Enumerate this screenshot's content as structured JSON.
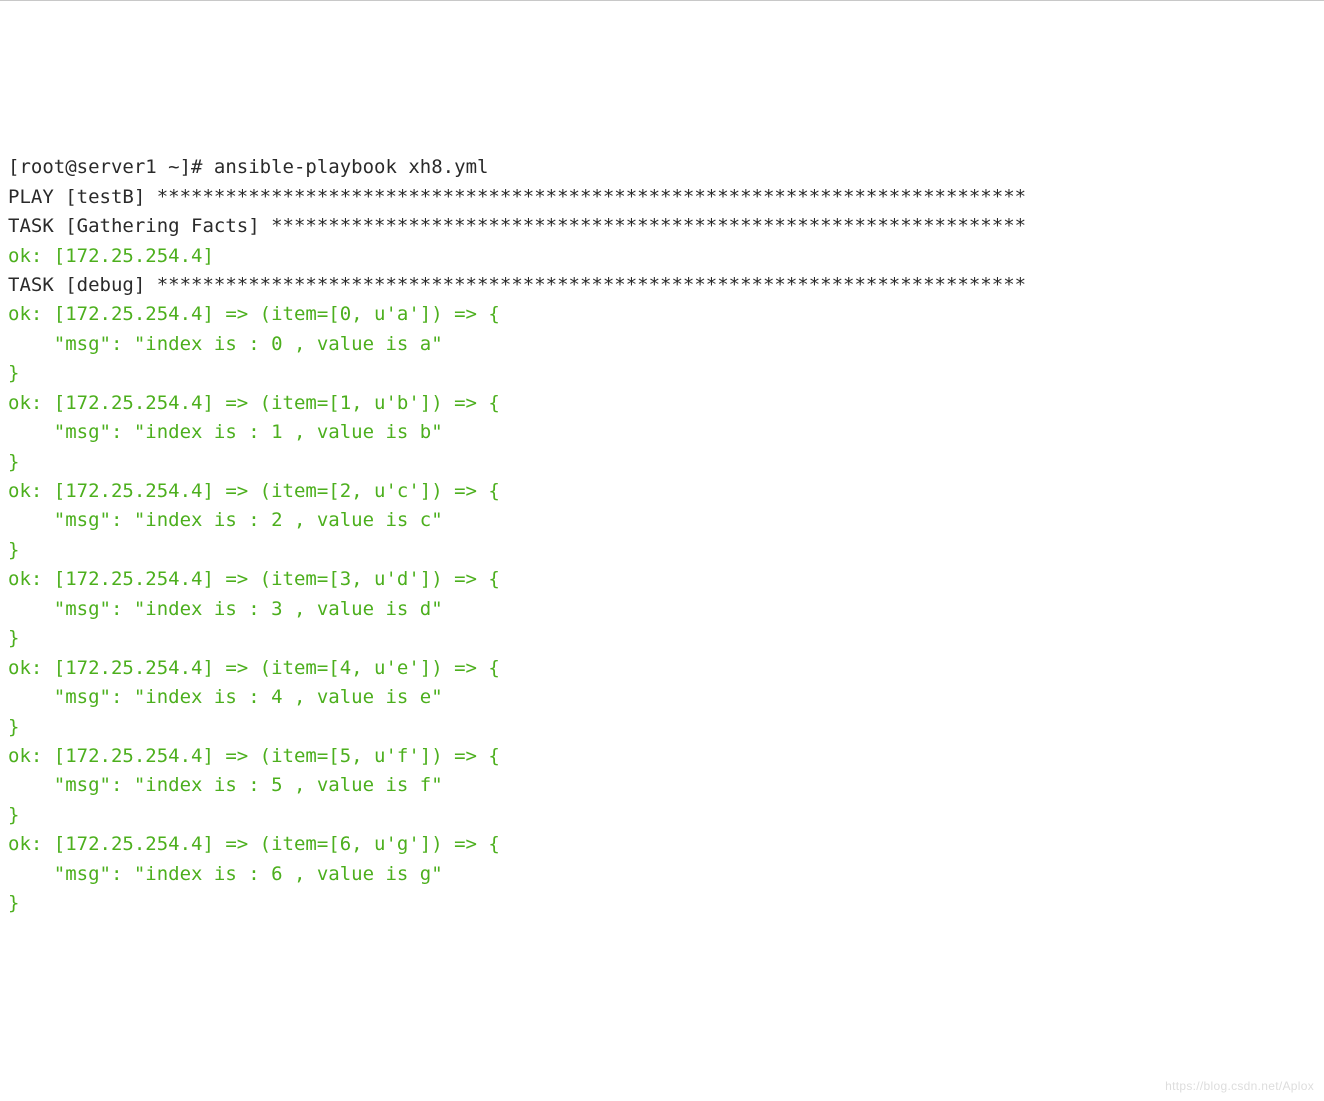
{
  "prompt": "[root@server1 ~]# ",
  "command": "ansible-playbook xh8.yml",
  "blank": "",
  "play_header": "PLAY [testB] ****************************************************************************",
  "task_gathering": "TASK [Gathering Facts] ******************************************************************",
  "gather_ok": "ok: [172.25.254.4]",
  "task_debug": "TASK [debug] ****************************************************************************",
  "items": [
    {
      "head": "ok: [172.25.254.4] => (item=[0, u'a']) => {",
      "msg": "    \"msg\": \"index is : 0 , value is a\"",
      "close": "}"
    },
    {
      "head": "ok: [172.25.254.4] => (item=[1, u'b']) => {",
      "msg": "    \"msg\": \"index is : 1 , value is b\"",
      "close": "}"
    },
    {
      "head": "ok: [172.25.254.4] => (item=[2, u'c']) => {",
      "msg": "    \"msg\": \"index is : 2 , value is c\"",
      "close": "}"
    },
    {
      "head": "ok: [172.25.254.4] => (item=[3, u'd']) => {",
      "msg": "    \"msg\": \"index is : 3 , value is d\"",
      "close": "}"
    },
    {
      "head": "ok: [172.25.254.4] => (item=[4, u'e']) => {",
      "msg": "    \"msg\": \"index is : 4 , value is e\"",
      "close": "}"
    },
    {
      "head": "ok: [172.25.254.4] => (item=[5, u'f']) => {",
      "msg": "    \"msg\": \"index is : 5 , value is f\"",
      "close": "}"
    },
    {
      "head": "ok: [172.25.254.4] => (item=[6, u'g']) => {",
      "msg": "    \"msg\": \"index is : 6 , value is g\"",
      "close": "}"
    }
  ],
  "watermark": "https://blog.csdn.net/Aplox"
}
